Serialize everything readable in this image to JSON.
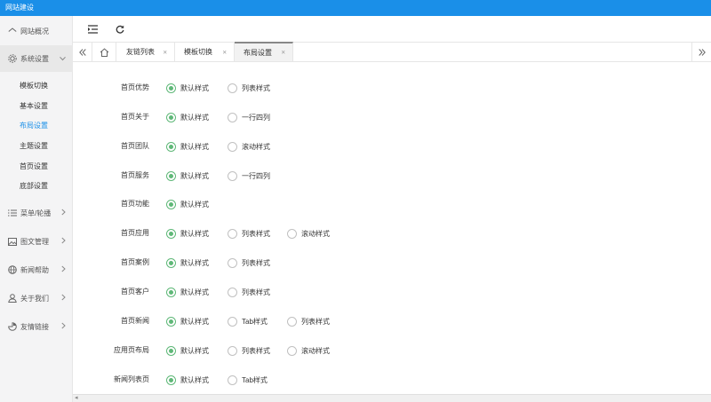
{
  "app": {
    "title": "网站建设"
  },
  "sidebar": {
    "items": [
      {
        "label": "网站概况",
        "icon": "home-icon"
      },
      {
        "label": "系统设置",
        "icon": "gear-icon",
        "expanded": true
      },
      {
        "label": "菜单/轮播",
        "icon": "list-icon"
      },
      {
        "label": "图文管理",
        "icon": "image-icon"
      },
      {
        "label": "新闻帮助",
        "icon": "globe-icon"
      },
      {
        "label": "关于我们",
        "icon": "users-icon"
      },
      {
        "label": "友情链接",
        "icon": "pie-icon"
      }
    ],
    "sub_items": [
      "模板切换",
      "基本设置",
      "布局设置",
      "主题设置",
      "首页设置",
      "底部设置"
    ],
    "current_sub": "布局设置"
  },
  "toolbar": {
    "menu_icon": "menu-fold-icon",
    "refresh_icon": "refresh-icon"
  },
  "tabs": [
    {
      "label": "友链列表",
      "closable": true
    },
    {
      "label": "模板切换",
      "closable": true
    },
    {
      "label": "布局设置",
      "closable": true,
      "active": true
    }
  ],
  "form": {
    "rows": [
      {
        "label": "首页优势",
        "options": [
          "默认样式",
          "列表样式"
        ],
        "selected": 0
      },
      {
        "label": "首页关于",
        "options": [
          "默认样式",
          "一行四列"
        ],
        "selected": 0
      },
      {
        "label": "首页团队",
        "options": [
          "默认样式",
          "滚动样式"
        ],
        "selected": 0
      },
      {
        "label": "首页服务",
        "options": [
          "默认样式",
          "一行四列"
        ],
        "selected": 0
      },
      {
        "label": "首页功能",
        "options": [
          "默认样式"
        ],
        "selected": 0
      },
      {
        "label": "首页应用",
        "options": [
          "默认样式",
          "列表样式",
          "滚动样式"
        ],
        "selected": 0
      },
      {
        "label": "首页案例",
        "options": [
          "默认样式",
          "列表样式"
        ],
        "selected": 0
      },
      {
        "label": "首页客户",
        "options": [
          "默认样式",
          "列表样式"
        ],
        "selected": 0
      },
      {
        "label": "首页新闻",
        "options": [
          "默认样式",
          "Tab样式",
          "列表样式"
        ],
        "selected": 0
      },
      {
        "label": "应用页布局",
        "options": [
          "默认样式",
          "列表样式",
          "滚动样式"
        ],
        "selected": 0
      },
      {
        "label": "新闻列表页",
        "options": [
          "默认样式",
          "Tab样式"
        ],
        "selected": 0
      }
    ]
  },
  "colors": {
    "titlebar": "#1a8fe8",
    "accent_link": "#1a8fe8",
    "radio_checked": "#5fb878"
  }
}
